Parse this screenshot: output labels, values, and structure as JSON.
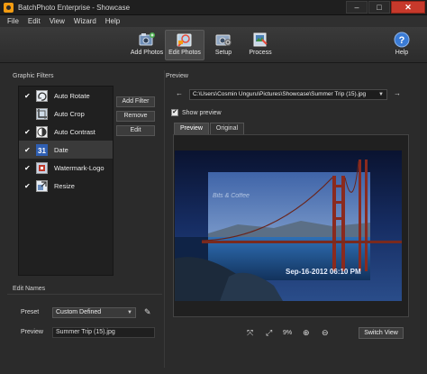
{
  "window": {
    "title": "BatchPhoto Enterprise - Showcase",
    "buttons": {
      "minimize": "–",
      "maximize": "□",
      "close": "✕"
    }
  },
  "menu": {
    "items": [
      "File",
      "Edit",
      "View",
      "Wizard",
      "Help"
    ]
  },
  "toolbar": {
    "add_photos": "Add Photos",
    "edit_photos": "Edit Photos",
    "setup": "Setup",
    "process": "Process",
    "help": "Help"
  },
  "graphic_filters": {
    "title": "Graphic Filters",
    "items": [
      {
        "label": "Auto Rotate",
        "checked": true,
        "icon": "auto-rotate-icon"
      },
      {
        "label": "Auto Crop",
        "checked": false,
        "icon": "auto-crop-icon"
      },
      {
        "label": "Auto Contrast",
        "checked": true,
        "icon": "auto-contrast-icon"
      },
      {
        "label": "Date",
        "checked": true,
        "icon": "date-icon",
        "selected": true
      },
      {
        "label": "Watermark-Logo",
        "checked": true,
        "icon": "watermark-icon"
      },
      {
        "label": "Resize",
        "checked": true,
        "icon": "resize-icon"
      }
    ],
    "add_filter": "Add Filter",
    "remove": "Remove",
    "edit": "Edit"
  },
  "edit_names": {
    "title": "Edit Names",
    "preset_label": "Preset",
    "preset_value": "Custom Defined",
    "preview_label": "Preview",
    "preview_value": "Summer Trip (15).jpg"
  },
  "preview": {
    "title": "Preview",
    "path": "C:\\Users\\Cosmin Unguru\\Pictures\\Showcase\\Summer Trip (15).jpg",
    "show_preview_label": "Show preview",
    "show_preview_checked": true,
    "tabs": [
      "Preview",
      "Original"
    ],
    "zoom": "9%",
    "switch_view": "Switch View",
    "date_stamp": "Sep-16-2012 06:10 PM",
    "watermark": "Bits & Coffee"
  },
  "colors": {
    "accent": "#f39c12",
    "close": "#c7392b",
    "date_icon": "#2f5fb3"
  }
}
